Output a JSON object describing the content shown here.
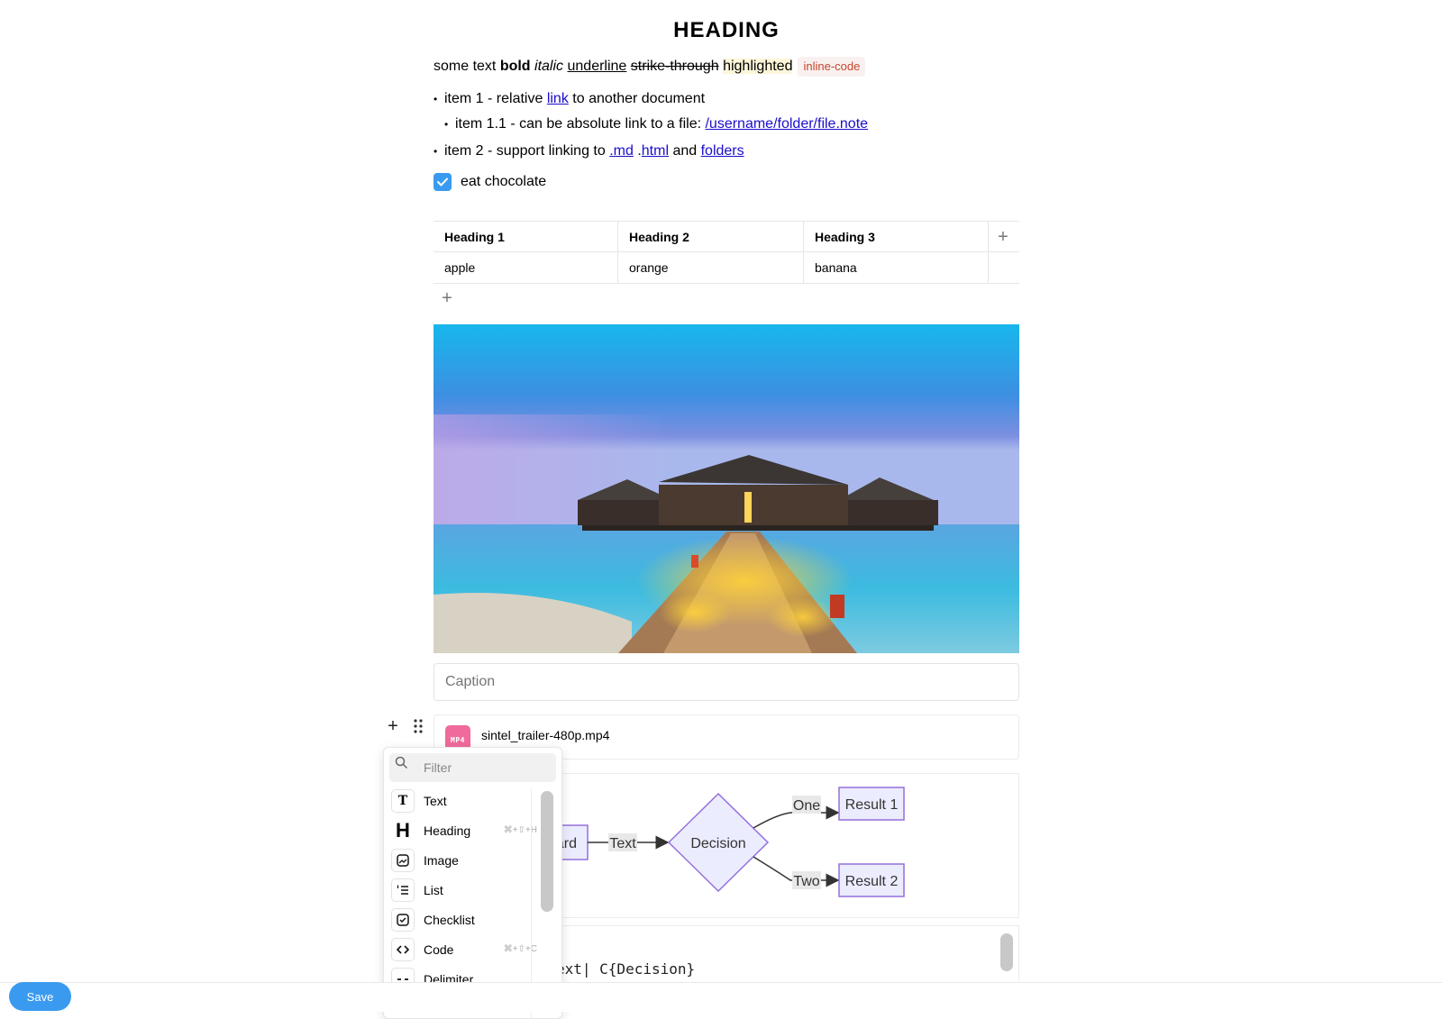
{
  "doc": {
    "heading": "HEADING",
    "para": {
      "plain": "some text ",
      "bold": "bold",
      "italic": "italic",
      "underline": "underline",
      "strike": "strike-through",
      "highlight": "highlighted",
      "code": "inline-code"
    },
    "list": {
      "item1": {
        "pre": "item 1 - relative ",
        "link": "link",
        "post": " to another document"
      },
      "item11": {
        "pre": "item 1.1 - can be absolute link to a file: ",
        "link": "/username/folder/file.note"
      },
      "item2": {
        "pre": "item 2 - support linking to ",
        "link_md": ".md",
        "sep": " .",
        "link_html": "html",
        "and": " and ",
        "link_folders": "folders"
      }
    },
    "checklist": {
      "label": "eat chocolate",
      "checked": true
    },
    "table": {
      "headers": [
        "Heading 1",
        "Heading 2",
        "Heading 3"
      ],
      "rows": [
        [
          "apple",
          "orange",
          "banana"
        ]
      ],
      "add_column": "+",
      "add_row": "+"
    },
    "image": {
      "caption_placeholder": "Caption"
    },
    "attachment": {
      "badge": "MP4",
      "filename": "sintel_trailer-480p.mp4"
    },
    "diagram": {
      "nodes": {
        "hard": "Hard",
        "decision": "Decision",
        "result1": "Result 1",
        "result2": "Result 2"
      },
      "edges": {
        "text": "Text",
        "one": "One",
        "two": "Two"
      }
    },
    "code": {
      "visible_line": "ext| C{Decision}"
    }
  },
  "block_handle": {
    "add": "+"
  },
  "menu": {
    "filter_placeholder": "Filter",
    "items": [
      {
        "label": "Text",
        "icon": "text-icon",
        "shortcut": ""
      },
      {
        "label": "Heading",
        "icon": "heading-icon",
        "shortcut": "⌘+⇧+H"
      },
      {
        "label": "Image",
        "icon": "image-icon",
        "shortcut": ""
      },
      {
        "label": "List",
        "icon": "list-icon",
        "shortcut": ""
      },
      {
        "label": "Checklist",
        "icon": "checklist-icon",
        "shortcut": ""
      },
      {
        "label": "Code",
        "icon": "code-icon",
        "shortcut": "⌘+⇧+C"
      },
      {
        "label": "Delimiter",
        "icon": "delimiter-icon",
        "shortcut": ""
      }
    ]
  },
  "footer": {
    "save_label": "Save"
  },
  "colors": {
    "accent": "#3a9af0",
    "link": "#1a0dcc",
    "code": "#c7442f",
    "mp4": "#f06a9b"
  }
}
